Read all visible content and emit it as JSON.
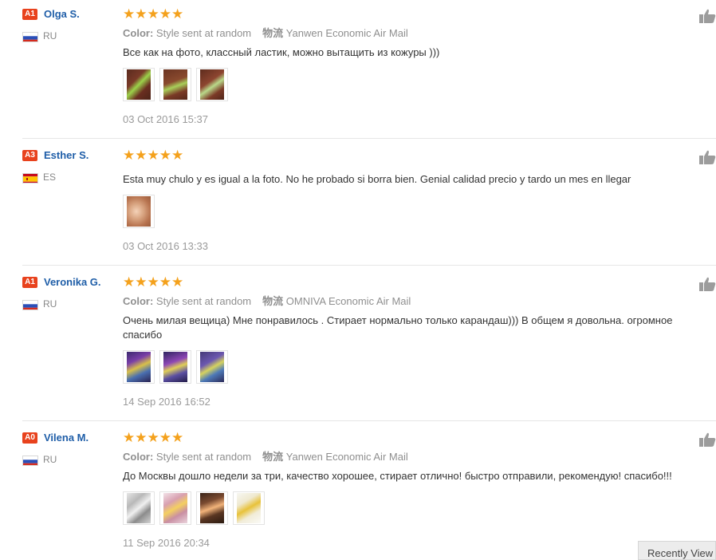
{
  "reviews": [
    {
      "level": "A1",
      "level_color": "#e8421d",
      "name": "Olga S.",
      "country": "RU",
      "flag": "russia-flag",
      "stars": "★★★★★",
      "rating": 5,
      "color_label": "Color:",
      "color_value": "Style sent at random",
      "logistics_label": "物流",
      "logistics_value": "Yanwen Economic Air Mail",
      "text": "Все как на фото, классный ластик, можно вытащить из кожуры )))",
      "date": "03 Oct 2016 15:37",
      "thumb_count": 3
    },
    {
      "level": "A3",
      "level_color": "#e8421d",
      "name": "Esther S.",
      "country": "ES",
      "flag": "spain-flag",
      "stars": "★★★★★",
      "rating": 5,
      "text": "Esta muy chulo y es igual a la foto. No he probado si borra bien. Genial calidad precio y tardo un mes en llegar",
      "date": "03 Oct 2016 13:33",
      "thumb_count": 1
    },
    {
      "level": "A1",
      "level_color": "#e8421d",
      "name": "Veronika G.",
      "country": "RU",
      "flag": "russia-flag",
      "stars": "★★★★★",
      "rating": 5,
      "color_label": "Color:",
      "color_value": "Style sent at random",
      "logistics_label": "物流",
      "logistics_value": "OMNIVA Economic Air Mail",
      "text": "Очень милая вещица) Мне понравилось . Стирает нормально только карандаш))) В общем я довольна. огромное спасибо",
      "date": "14 Sep 2016 16:52",
      "thumb_count": 3
    },
    {
      "level": "A0",
      "level_color": "#e8421d",
      "name": "Vilena M.",
      "country": "RU",
      "flag": "russia-flag",
      "stars": "★★★★★",
      "rating": 5,
      "color_label": "Color:",
      "color_value": "Style sent at random",
      "logistics_label": "物流",
      "logistics_value": "Yanwen Economic Air Mail",
      "text": "До Москвы дошло недели за три, качество хорошее, стирает отлично! быстро отправили, рекомендую! спасибо!!!",
      "date": "11 Sep 2016 20:34",
      "thumb_count": 4
    }
  ],
  "recently_viewed": {
    "label": "Recently View"
  },
  "colors": {
    "name_link": "#1f5ea8",
    "stars": "#f4a11c",
    "meta": "#8f8f8f",
    "divider": "#e6e6e6"
  }
}
